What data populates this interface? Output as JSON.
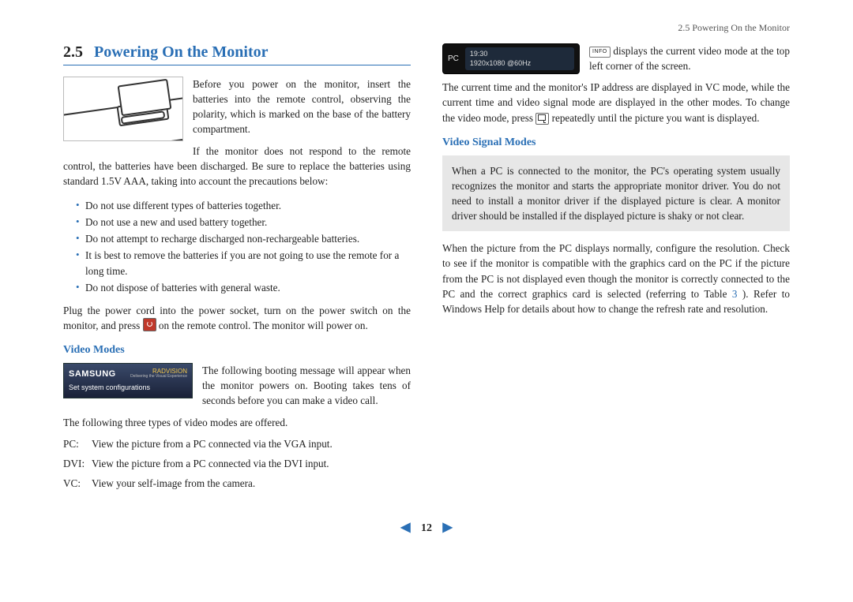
{
  "header": {
    "running": "2.5 Powering On the Monitor"
  },
  "section": {
    "number": "2.5",
    "title": "Powering On the Monitor"
  },
  "left": {
    "intro1": "Before you power on the monitor, insert the batteries into the remote control, observing the polarity, which is marked on the base of the battery compartment.",
    "intro2": "If the monitor does not respond to the remote control, the batteries have been discharged. Be sure to replace the batteries using standard 1.5V AAA, taking into account the precautions below:",
    "bullets": [
      "Do not use different types of batteries together.",
      "Do not use a new and used battery together.",
      "Do not attempt to recharge discharged non-rechargeable batteries.",
      "It is best to remove the batteries if you are not going to use the remote for a long time.",
      "Do not dispose of batteries with general waste."
    ],
    "plug_before": "Plug the power cord into the power socket, turn on the power switch on the monitor, and press ",
    "plug_after": " on the remote control. The monitor will power on.",
    "sub_video_modes": "Video Modes",
    "boot": {
      "samsung": "SAMSUNG",
      "radvision": "RADVISION",
      "rad_sub": "Delivering the Visual Experience",
      "msg": "Set system configurations"
    },
    "boot_text": "The following booting message will appear when the monitor powers on. Booting takes tens of seconds before you can make a video call.",
    "modes_intro": "The following three types of video modes are offered.",
    "modes": [
      {
        "label": "PC:",
        "desc": "View the picture from a PC connected via the VGA input."
      },
      {
        "label": "DVI:",
        "desc": "View the picture from a PC connected via the DVI input."
      },
      {
        "label": "VC:",
        "desc": "View your self-image from the camera."
      }
    ]
  },
  "right": {
    "osd": {
      "mode": "PC",
      "time": "19:30",
      "res": "1920x1080 @60Hz"
    },
    "info_label": "INFO",
    "info_after": " displays the current video mode at the top left corner of the screen.",
    "current_before": "The current time and the monitor's IP address are displayed in VC mode, while the current time and video signal mode are displayed in the other modes. To change the video mode, press ",
    "current_after": " repeatedly until the picture you want is displayed.",
    "sub_signal": "Video Signal Modes",
    "note": "When a PC is connected to the monitor, the PC's operating system usually recognizes the monitor and starts the appropriate monitor driver. You do not need to install a monitor driver if the displayed picture is clear. A monitor driver should be installed if the displayed picture is shaky or not clear.",
    "resolution_before": "When the picture from the PC displays normally, configure the resolution. Check to see if the monitor is compatible with the graphics card on the PC if the picture from the PC is not displayed even though the monitor is correctly connected to the PC and the correct graphics card is selected (referring to Table ",
    "table_ref": "3",
    "resolution_after": " ). Refer to Windows Help for details about how to change the refresh rate and resolution."
  },
  "pager": {
    "page": "12"
  }
}
